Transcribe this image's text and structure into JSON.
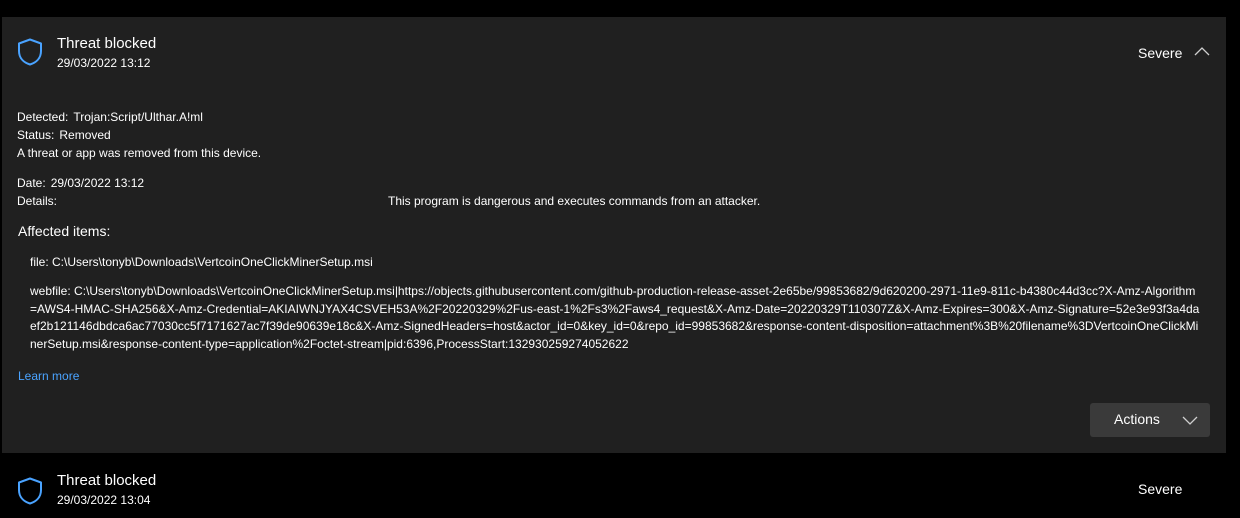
{
  "threats": [
    {
      "title": "Threat blocked",
      "timestamp": "29/03/2022 13:12",
      "severity": "Severe",
      "expanded": true,
      "detected_label": "Detected:",
      "detected_value": "Trojan:Script/Ulthar.A!ml",
      "status_label": "Status:",
      "status_value": "Removed",
      "status_message": "A threat or app was removed from this device.",
      "date_label": "Date:",
      "date_value": "29/03/2022 13:12",
      "details_label": "Details:",
      "details_value": "This program is dangerous and executes commands from an attacker.",
      "affected_heading": "Affected items:",
      "affected_items": [
        "file: C:\\Users\\tonyb\\Downloads\\VertcoinOneClickMinerSetup.msi",
        "webfile: C:\\Users\\tonyb\\Downloads\\VertcoinOneClickMinerSetup.msi|https://objects.githubusercontent.com/github-production-release-asset-2e65be/99853682/9d620200-2971-11e9-811c-b4380c44d3cc?X-Amz-Algorithm=AWS4-HMAC-SHA256&X-Amz-Credential=AKIAIWNJYAX4CSVEH53A%2F20220329%2Fus-east-1%2Fs3%2Faws4_request&X-Amz-Date=20220329T110307Z&X-Amz-Expires=300&X-Amz-Signature=52e3e93f3a4daef2b121146dbdca6ac77030cc5f7171627ac7f39de90639e18c&X-Amz-SignedHeaders=host&actor_id=0&key_id=0&repo_id=99853682&response-content-disposition=attachment%3B%20filename%3DVertcoinOneClickMinerSetup.msi&response-content-type=application%2Foctet-stream|pid:6396,ProcessStart:132930259274052622"
      ],
      "learn_more": "Learn more",
      "actions_label": "Actions"
    },
    {
      "title": "Threat blocked",
      "timestamp": "29/03/2022 13:04",
      "severity": "Severe",
      "expanded": false
    }
  ],
  "icons": {
    "shield": "shield-icon",
    "chevron_up": "chevron-up-icon",
    "chevron_down": "chevron-down-icon"
  },
  "colors": {
    "background": "#000000",
    "card": "#202020",
    "accent": "#4aa3ff",
    "button": "#3a3a3a"
  }
}
